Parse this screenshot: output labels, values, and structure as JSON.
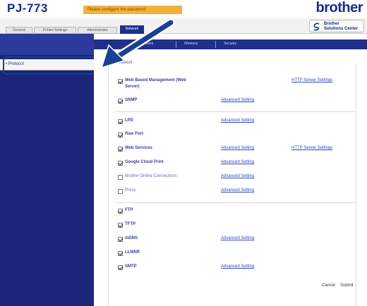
{
  "header": {
    "model": "PJ-773",
    "notice": "Please configure the password",
    "brand": "brother"
  },
  "tabs": [
    {
      "label": "General"
    },
    {
      "label": "Printer Settings"
    },
    {
      "label": "Administrator"
    },
    {
      "label": "Network",
      "active": true
    }
  ],
  "solutions_center": {
    "line1": "Brother",
    "line2": "Solutions Center"
  },
  "subtabs": [
    "Network",
    "Wireless",
    "Security"
  ],
  "sidebar": {
    "items": [
      {
        "label": "Protocol"
      }
    ]
  },
  "section": {
    "title": "Protocol"
  },
  "protocols": [
    {
      "label": "Web Based Management (Web",
      "label2": "Server)",
      "checked": true,
      "link2": "HTTP Server Settings"
    },
    {
      "label": "SNMP",
      "checked": true,
      "link1": "Advanced Setting"
    },
    {
      "label": "LPD",
      "checked": true,
      "link1": "Advanced Setting"
    },
    {
      "label": "Raw Port",
      "checked": true
    },
    {
      "label": "Web Services",
      "checked": true,
      "link1": "Advanced Setting",
      "link2": "HTTP Server Settings"
    },
    {
      "label": "Google Cloud Print",
      "checked": true,
      "link1": "Advanced Setting"
    },
    {
      "label": "Brother Online Connections",
      "checked": false,
      "link1": "Advanced Setting"
    },
    {
      "label": "Proxy",
      "checked": false,
      "link1": "Advanced Setting"
    },
    {
      "label": "FTP",
      "checked": true
    },
    {
      "label": "TFTP",
      "checked": true
    },
    {
      "label": "mDNS",
      "checked": true,
      "link1": "Advanced Setting"
    },
    {
      "label": "LLMNR",
      "checked": true
    },
    {
      "label": "SMTP",
      "checked": true,
      "link1": "Advanced Setting"
    }
  ],
  "buttons": {
    "cancel": "Cancel",
    "submit": "Submit"
  },
  "colors": {
    "brand": "#1a2a8a",
    "nav": "#1c2578",
    "highlight": "#1b3f92",
    "notice": "#f0b23c"
  }
}
